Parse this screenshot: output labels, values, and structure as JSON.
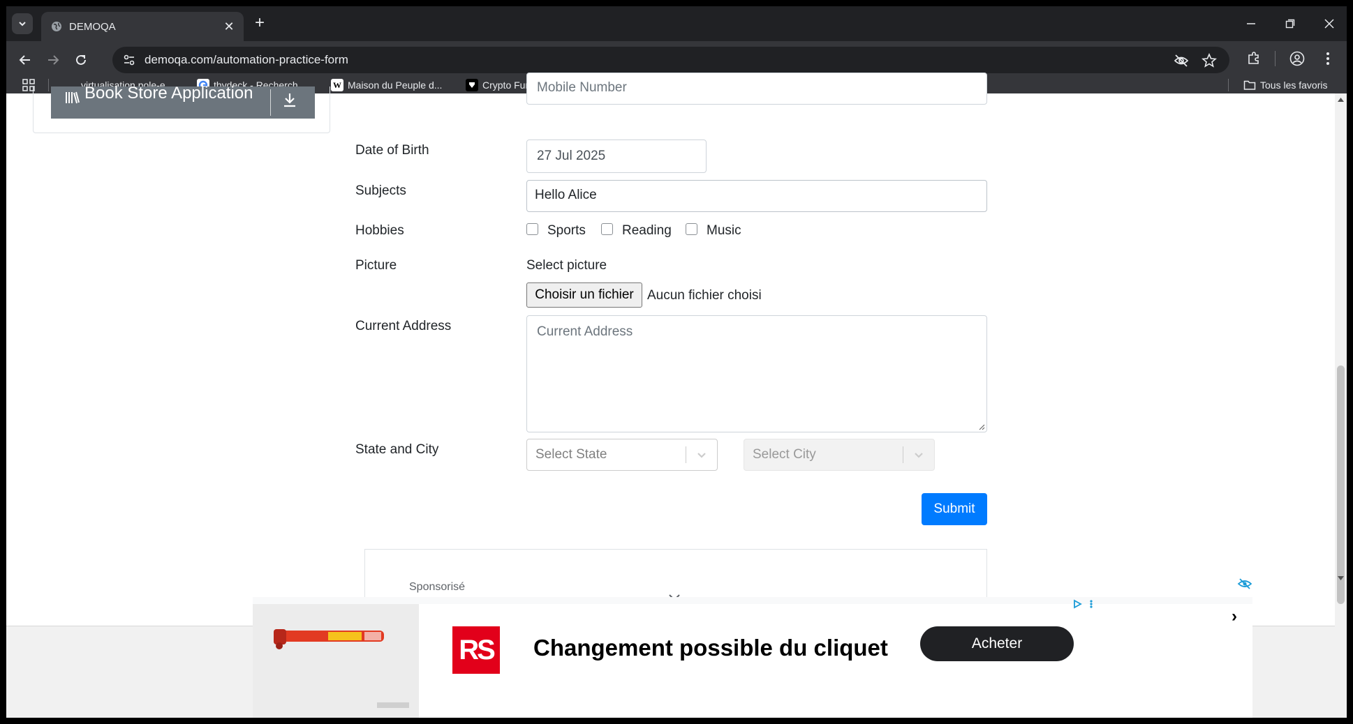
{
  "tab": {
    "title": "DEMOQA"
  },
  "address_bar": {
    "url": "demoqa.com/automation-practice-form"
  },
  "bookmarks": {
    "items": [
      {
        "label": "virtualisation.pole-e..."
      },
      {
        "label": "thydeck - Recherch..."
      },
      {
        "label": "Maison du Peuple d..."
      },
      {
        "label": "Crypto Funding Rat..."
      }
    ],
    "all_bookmarks": "Tous les favoris"
  },
  "sidebar": {
    "book_store_label": "Book Store Application"
  },
  "form": {
    "mobile_placeholder": "Mobile Number",
    "dob_label": "Date of Birth",
    "dob_value": "27 Jul 2025",
    "subjects_label": "Subjects",
    "subjects_value": "Hello Alice",
    "hobbies_label": "Hobbies",
    "hobbies": [
      "Sports",
      "Reading",
      "Music"
    ],
    "picture_label": "Picture",
    "select_picture": "Select picture",
    "file_button": "Choisir un fichier",
    "file_status": "Aucun fichier choisi",
    "address_label": "Current Address",
    "address_placeholder": "Current Address",
    "state_city_label": "State and City",
    "state_placeholder": "Select State",
    "city_placeholder": "Select City",
    "submit_label": "Submit"
  },
  "ad": {
    "sponsored": "Sponsorisé",
    "brand": "RS",
    "headline": "Changement possible du cliquet",
    "cta": "Acheter",
    "next": "›"
  },
  "colors": {
    "primary": "#007bff",
    "secondary": "#6c757d",
    "rs_red": "#e2001a"
  }
}
